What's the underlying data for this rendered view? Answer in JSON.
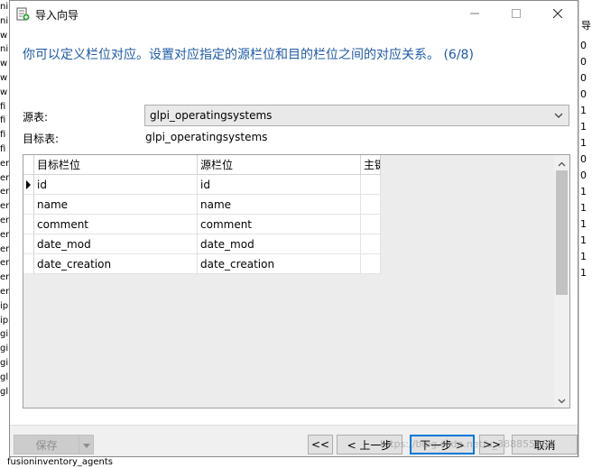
{
  "background": {
    "left_letters": [
      "ni",
      "ni",
      "w",
      "ni",
      "w",
      "w",
      "w",
      "fi",
      "fi",
      "fi",
      "fi",
      "er",
      "er",
      "er",
      "er",
      "er",
      "er",
      "er",
      "er",
      "er",
      "er",
      "ip",
      "ip",
      "gi",
      "gi",
      "gi",
      "gl",
      "gl"
    ],
    "right_header": "导",
    "right_values": [
      "0",
      "0",
      "0",
      "0",
      "1",
      "1",
      "1",
      "0",
      "0",
      "1",
      "1",
      "1",
      "1",
      "1",
      "1"
    ],
    "bottom_text": "fusioninventory_agents"
  },
  "dialog": {
    "title": "导入向导",
    "heading": "你可以定义栏位对应。设置对应指定的源栏位和目的栏位之间的对应关系。 (6/8)",
    "source_label": "源表:",
    "source_value": "glpi_operatingsystems",
    "target_label": "目标表:",
    "target_value": "glpi_operatingsystems",
    "grid": {
      "headers": [
        "目标栏位",
        "源栏位",
        "主键"
      ],
      "rows": [
        [
          "id",
          "id"
        ],
        [
          "name",
          "name"
        ],
        [
          "comment",
          "comment"
        ],
        [
          "date_mod",
          "date_mod"
        ],
        [
          "date_creation",
          "date_creation"
        ]
      ]
    },
    "buttons": {
      "save": "保存",
      "first": "<<",
      "back": "< 上一步",
      "next": "下一步 >",
      "last": ">>",
      "cancel": "取消"
    },
    "watermark": "https://blog.csdn.net/u_38885588"
  },
  "icons": [
    "import-wizard-icon",
    "minimize-icon",
    "maximize-icon",
    "close-icon",
    "chevron-down-icon",
    "row-pointer-icon",
    "scroll-up-icon",
    "scroll-down-icon"
  ]
}
